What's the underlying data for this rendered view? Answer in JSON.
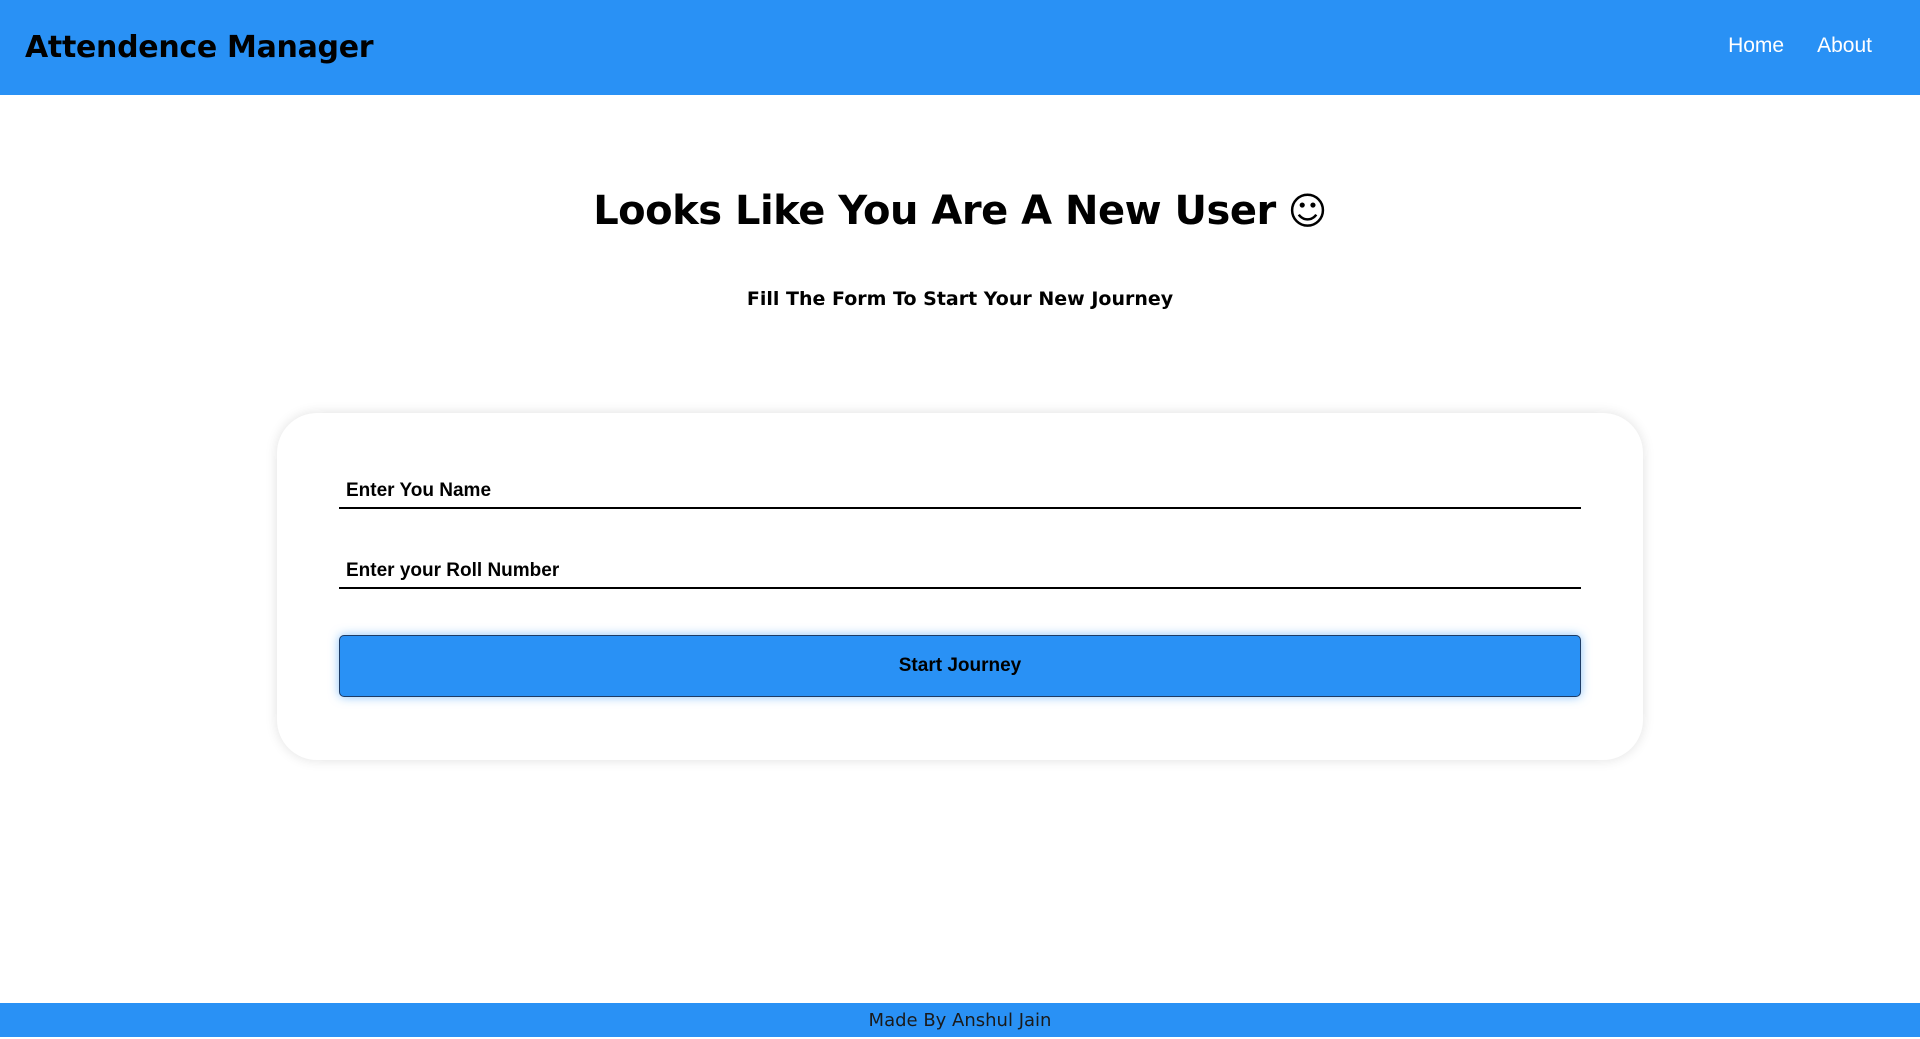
{
  "navbar": {
    "brand": "Attendence Manager",
    "links": [
      {
        "label": "Home"
      },
      {
        "label": "About"
      }
    ]
  },
  "hero": {
    "title": "Looks Like You Are A New User",
    "emoji": "☺",
    "subtitle": "Fill The Form To Start Your New Journey"
  },
  "form": {
    "name_field": {
      "placeholder": "Enter You Name",
      "value": ""
    },
    "roll_field": {
      "placeholder": "Enter your Roll Number",
      "value": ""
    },
    "submit_label": "Start Journey"
  },
  "footer": {
    "text": "Made By Anshul Jain"
  },
  "colors": {
    "primary": "#2991f5",
    "background": "#ffffff",
    "text": "#000000"
  }
}
